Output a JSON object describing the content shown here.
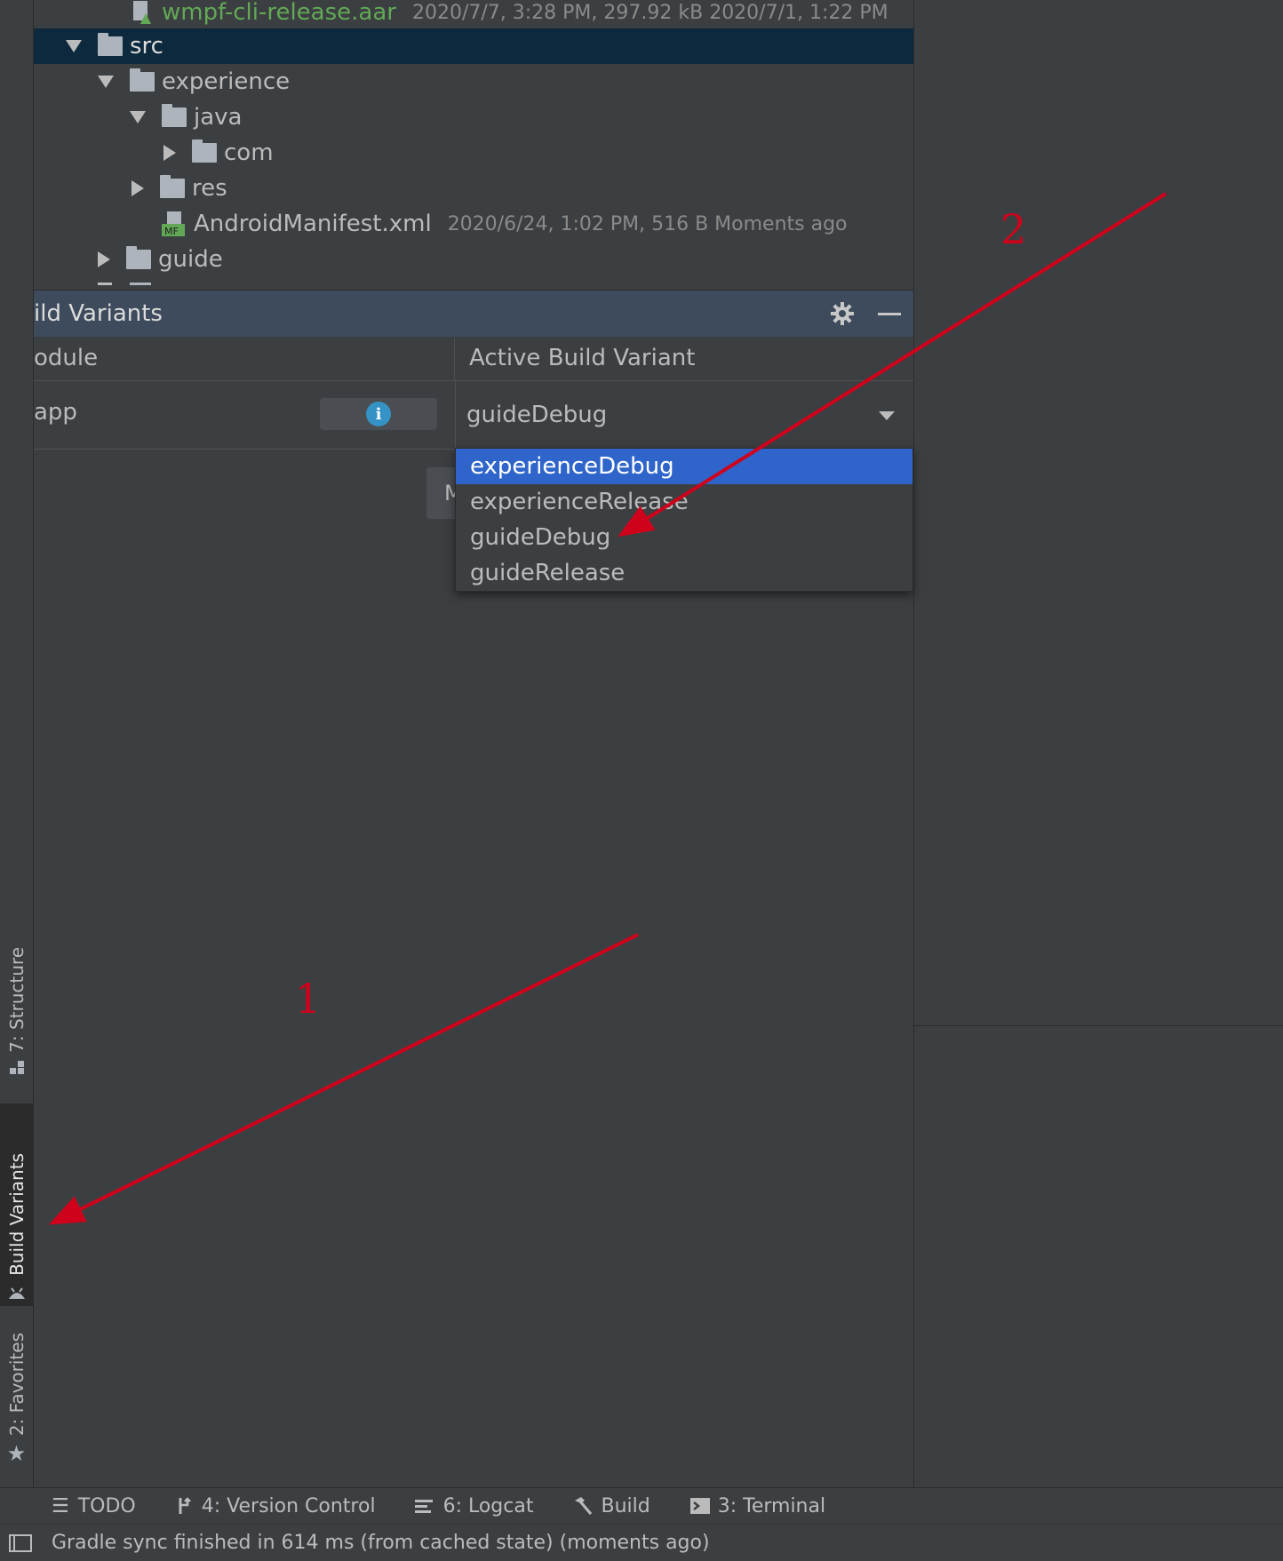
{
  "project_tree": {
    "items": [
      {
        "name": "wmpf-cli-release.aar",
        "meta": "2020/7/7, 3:28 PM, 297.92 kB 2020/7/1, 1:22 PM"
      },
      {
        "name": "src"
      },
      {
        "name": "experience"
      },
      {
        "name": "java"
      },
      {
        "name": "com"
      },
      {
        "name": "res"
      },
      {
        "name": "AndroidManifest.xml",
        "meta": "2020/6/24, 1:02 PM, 516 B Moments ago",
        "icon_text": "MF"
      },
      {
        "name": "guide"
      }
    ]
  },
  "build_variants_panel": {
    "title": "ild Variants",
    "col_module": "odule",
    "col_active": "Active Build Variant",
    "module_name": "app",
    "selected_variant": "guideDebug",
    "hidden_button_letter": "M"
  },
  "dropdown": {
    "options": [
      "experienceDebug",
      "experienceRelease",
      "guideDebug",
      "guideRelease"
    ],
    "highlighted": "experienceDebug"
  },
  "side_tabs": {
    "structure": "7: Structure",
    "build_variants": "Build Variants",
    "favorites": "2: Favorites"
  },
  "bottom_tabs": [
    {
      "icon": "list-icon",
      "label": "TODO"
    },
    {
      "icon": "version-control-icon",
      "label": "4: Version Control"
    },
    {
      "icon": "logcat-icon",
      "label": "6: Logcat"
    },
    {
      "icon": "hammer-icon",
      "label": "Build"
    },
    {
      "icon": "terminal-icon",
      "label": "3: Terminal"
    }
  ],
  "status": {
    "message": "Gradle sync finished in 614 ms (from cached state) (moments ago)"
  },
  "annotations": {
    "label_1": "1",
    "label_2": "2",
    "arrow_color": "#d0021b"
  },
  "colors": {
    "selection": "#0d293e",
    "highlight": "#2f65ca",
    "file_green": "#62a856",
    "panel_header": "#3d4b5c"
  }
}
